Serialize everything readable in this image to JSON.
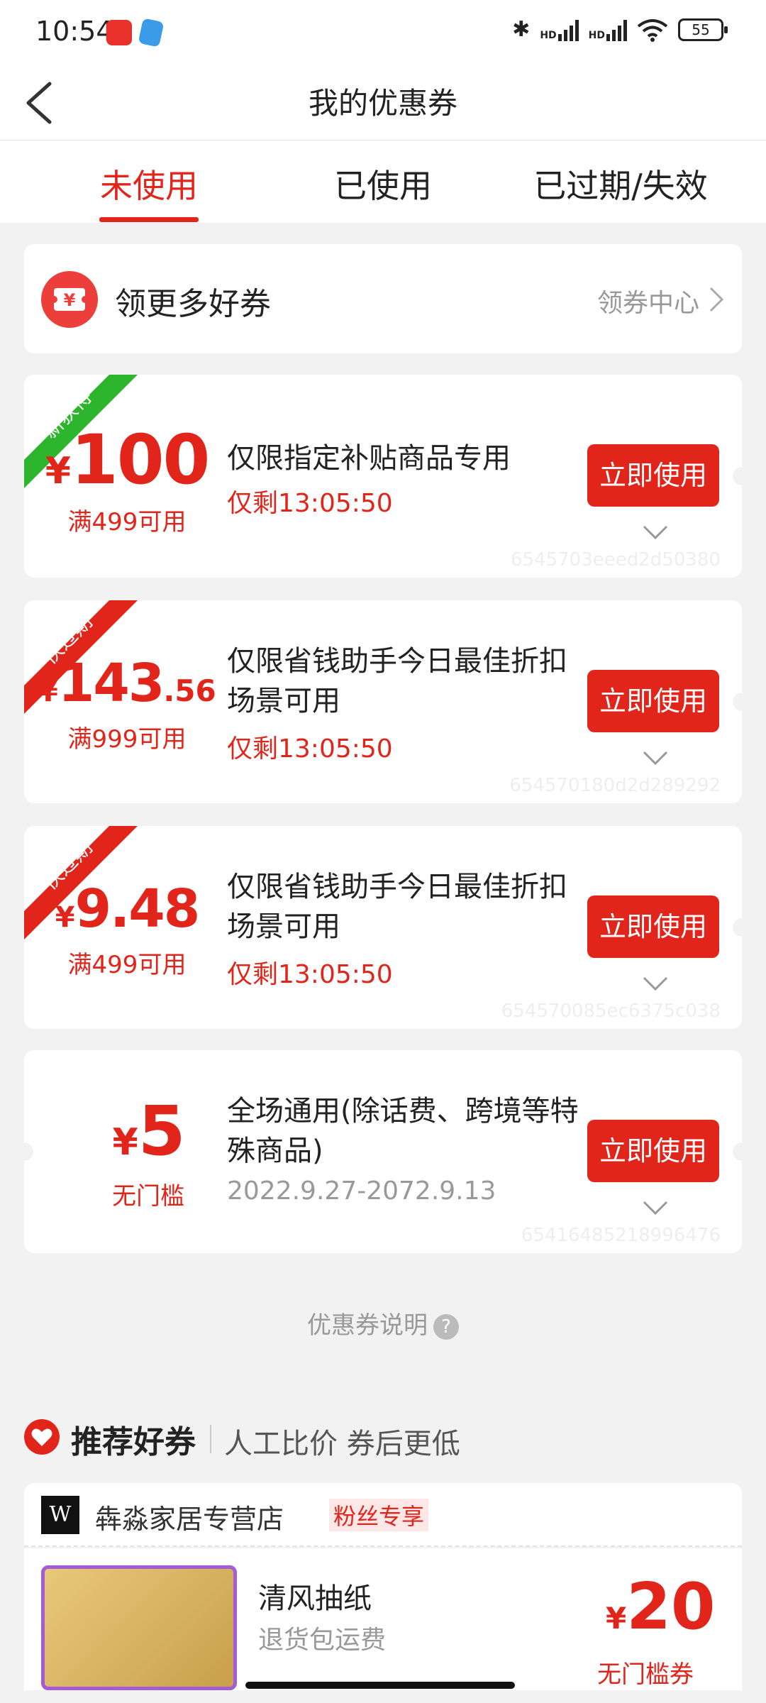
{
  "status_bar": {
    "time": "10:54",
    "battery": "55",
    "signal_label_1": "HD",
    "signal_label_2": "HD"
  },
  "header": {
    "title": "我的优惠券"
  },
  "tabs": [
    {
      "label": "未使用"
    },
    {
      "label": "已使用"
    },
    {
      "label": "已过期/失效"
    }
  ],
  "more_coupons": {
    "title": "领更多好券",
    "link": "领券中心"
  },
  "coupons": [
    {
      "badge": "新获得",
      "currency": "¥",
      "amount_int": "100",
      "amount_dec": "",
      "condition": "满499可用",
      "description": "仅限指定补贴商品专用",
      "expire": "仅剩13:05:50",
      "button": "立即使用",
      "code": "6545703eeed2d50380"
    },
    {
      "badge": "快过期",
      "currency": "¥",
      "amount_int": "143",
      "amount_dec": ".56",
      "condition": "满999可用",
      "description": "仅限省钱助手今日最佳折扣场景可用",
      "expire": "仅剩13:05:50",
      "button": "立即使用",
      "code": "654570180d2d289292"
    },
    {
      "badge": "快过期",
      "currency": "¥",
      "amount_int": "9.48",
      "amount_dec": "",
      "condition": "满499可用",
      "description": "仅限省钱助手今日最佳折扣场景可用",
      "expire": "仅剩13:05:50",
      "button": "立即使用",
      "code": "654570085ec6375c038"
    },
    {
      "badge": "",
      "currency": "¥",
      "amount_int": "5",
      "amount_dec": "",
      "condition": "无门槛",
      "description": "全场通用(除话费、跨境等特殊商品)",
      "expire": "2022.9.27-2072.9.13",
      "button": "立即使用",
      "code": "65416485218996476"
    }
  ],
  "explain": {
    "label": "优惠券说明",
    "help": "?"
  },
  "recommend": {
    "title": "推荐好券",
    "subtitle": "人工比价 券后更低"
  },
  "shop": {
    "logo": "W",
    "name": "犇淼家居专营店",
    "tag": "粉丝专享"
  },
  "product": {
    "name": "清风抽纸",
    "subtitle": "退货包运费",
    "currency": "¥",
    "price": "20",
    "condition": "无门槛券"
  },
  "colors": {
    "accent": "#e1251b",
    "badge_new": "#2db52d",
    "badge_expiring": "#e1251b",
    "background": "#f2f2f2"
  }
}
